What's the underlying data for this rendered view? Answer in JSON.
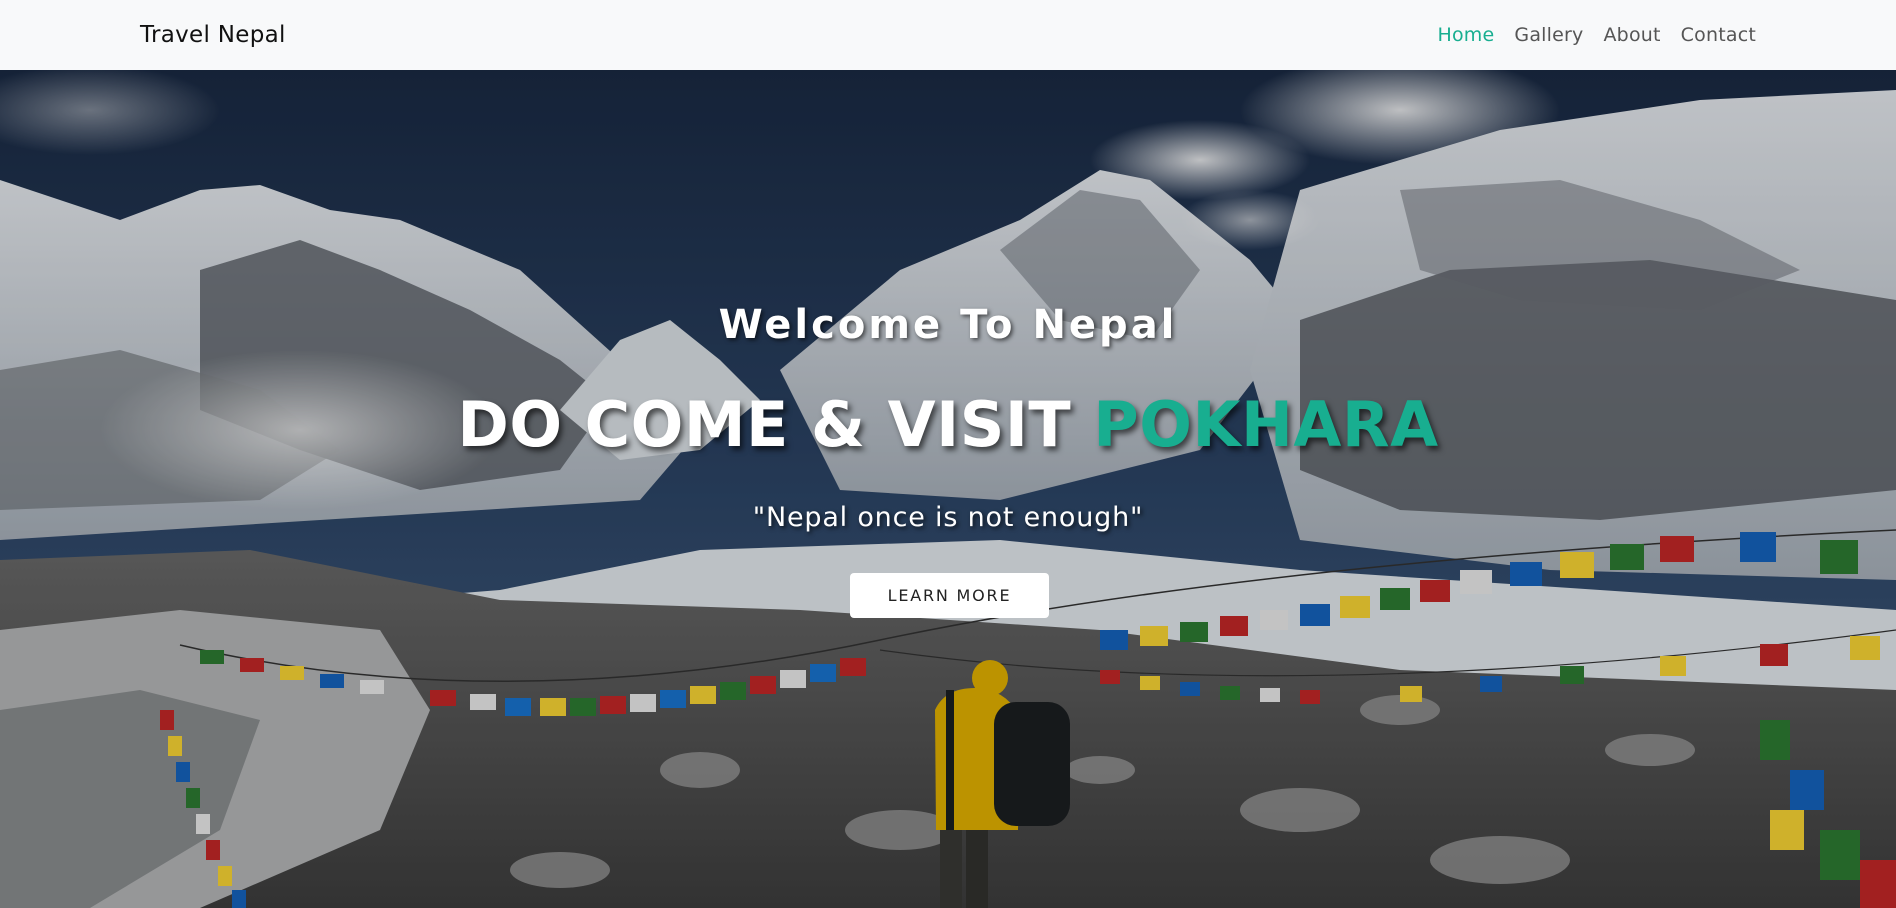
{
  "navbar": {
    "brand": "Travel Nepal",
    "links": [
      {
        "label": "Home",
        "active": true
      },
      {
        "label": "Gallery",
        "active": false
      },
      {
        "label": "About",
        "active": false
      },
      {
        "label": "Contact",
        "active": false
      }
    ]
  },
  "hero": {
    "welcome": "Welcome To Nepal",
    "headline_main": "DO COME & VISIT ",
    "headline_accent": "POKHARA",
    "tagline": "\"Nepal once is not enough\"",
    "cta_label": "LEARN MORE"
  },
  "colors": {
    "accent": "#18ae90",
    "navbar_bg": "#f8f9fa"
  }
}
